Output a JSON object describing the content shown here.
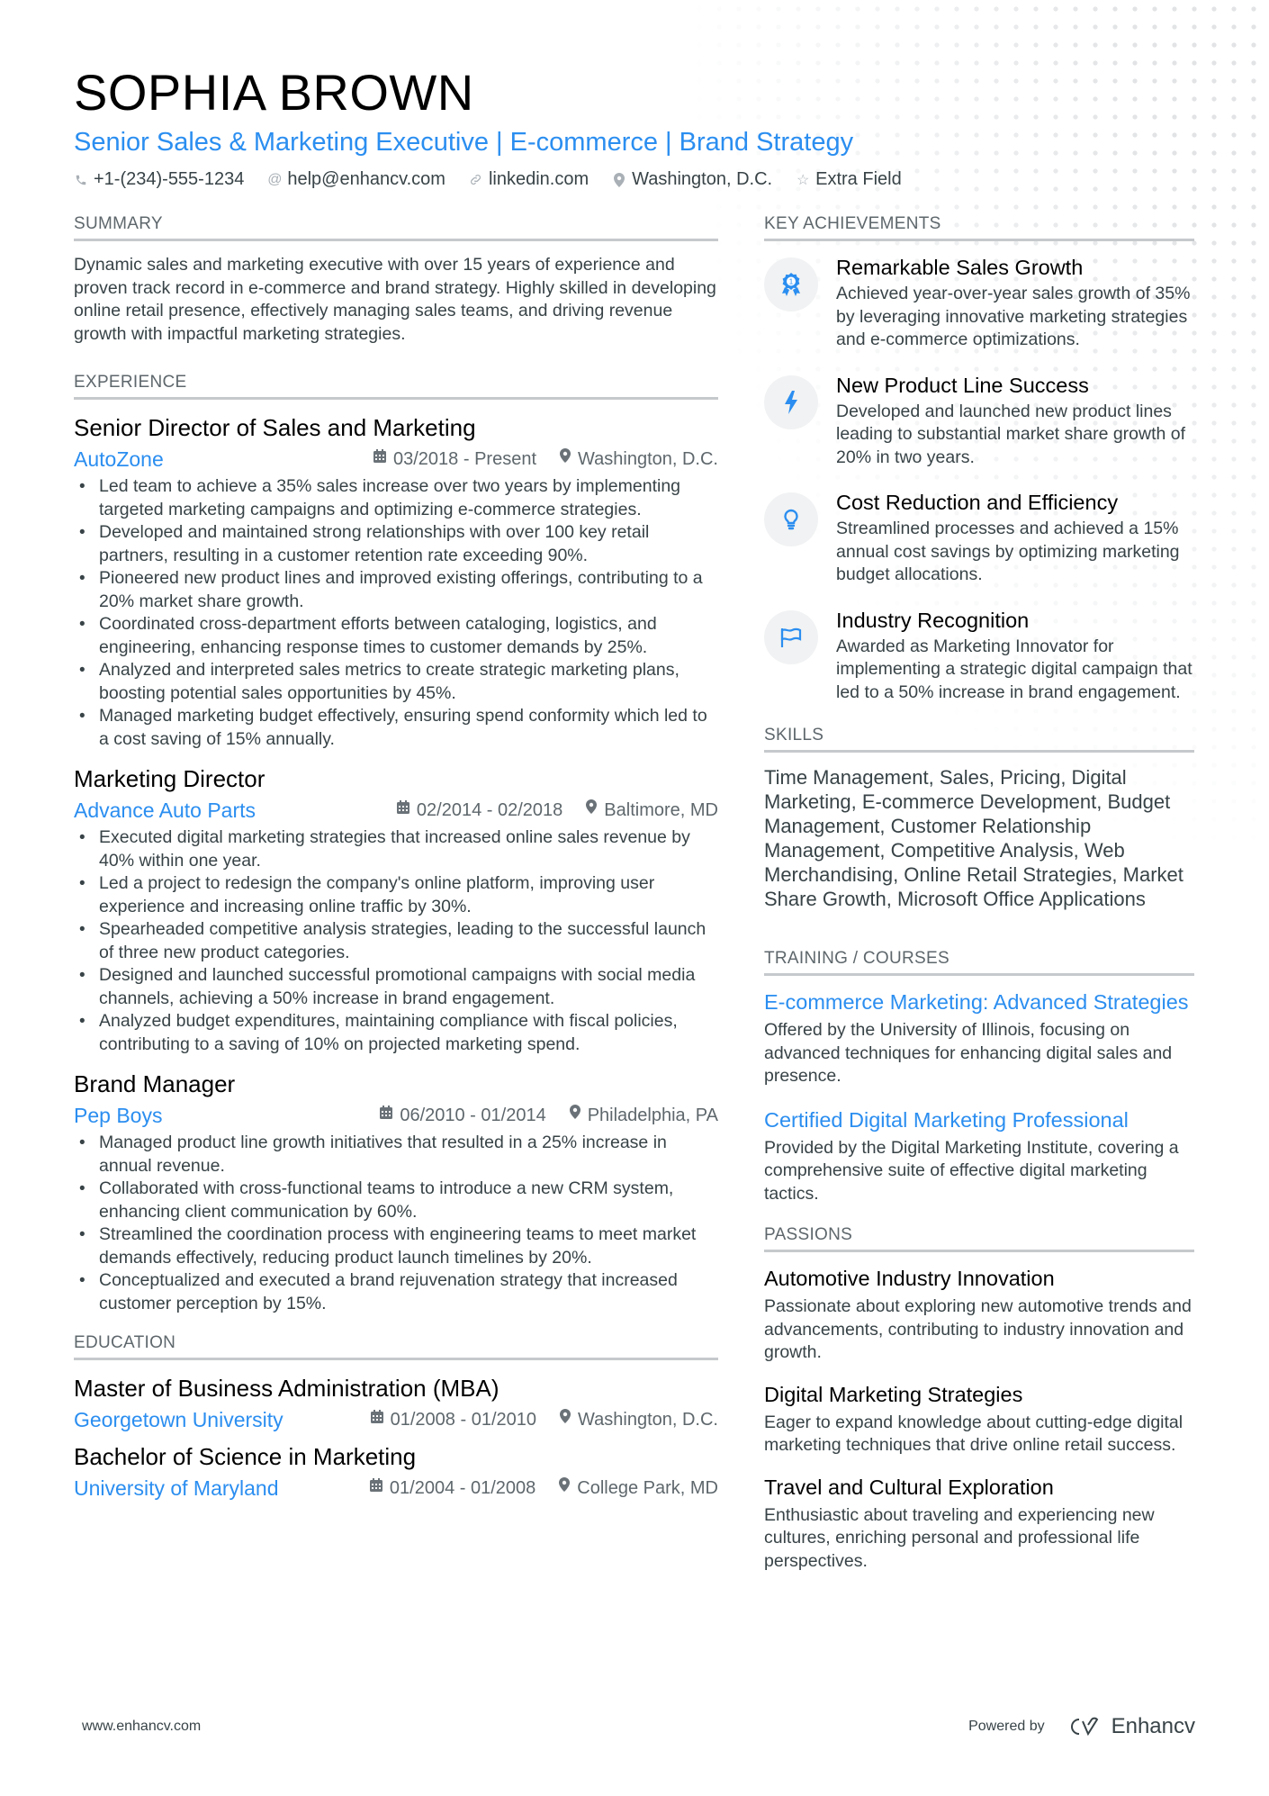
{
  "header": {
    "name": "SOPHIA BROWN",
    "headline": "Senior Sales & Marketing Executive | E-commerce | Brand Strategy",
    "contacts": [
      {
        "icon": "phone-icon",
        "glyph": "✆",
        "text": "+1-(234)-555-1234"
      },
      {
        "icon": "at-icon",
        "glyph": "@",
        "text": "help@enhancv.com"
      },
      {
        "icon": "link-icon",
        "glyph": "🔗",
        "text": "linkedin.com"
      },
      {
        "icon": "location-pin-icon",
        "glyph": "●",
        "text": "Washington, D.C."
      },
      {
        "icon": "star-icon",
        "glyph": "☆",
        "text": "Extra Field"
      }
    ]
  },
  "summary": {
    "title": "SUMMARY",
    "text": "Dynamic sales and marketing executive with over 15 years of experience and proven track record in e-commerce and brand strategy. Highly skilled in developing online retail presence, effectively managing sales teams, and driving revenue growth with impactful marketing strategies."
  },
  "experience": {
    "title": "EXPERIENCE",
    "jobs": [
      {
        "title": "Senior Director of Sales and Marketing",
        "company": "AutoZone",
        "dates": "03/2018 - Present",
        "location": "Washington, D.C.",
        "bullets": [
          "Led team to achieve a 35% sales increase over two years by implementing targeted marketing campaigns and optimizing e-commerce strategies.",
          "Developed and maintained strong relationships with over 100 key retail partners, resulting in a customer retention rate exceeding 90%.",
          "Pioneered new product lines and improved existing offerings, contributing to a 20% market share growth.",
          "Coordinated cross-department efforts between cataloging, logistics, and engineering, enhancing response times to customer demands by 25%.",
          "Analyzed and interpreted sales metrics to create strategic marketing plans, boosting potential sales opportunities by 45%.",
          "Managed marketing budget effectively, ensuring spend conformity which led to a cost saving of 15% annually."
        ]
      },
      {
        "title": "Marketing Director",
        "company": "Advance Auto Parts",
        "dates": "02/2014 - 02/2018",
        "location": "Baltimore, MD",
        "bullets": [
          "Executed digital marketing strategies that increased online sales revenue by 40% within one year.",
          "Led a project to redesign the company's online platform, improving user experience and increasing online traffic by 30%.",
          "Spearheaded competitive analysis strategies, leading to the successful launch of three new product categories.",
          "Designed and launched successful promotional campaigns with social media channels, achieving a 50% increase in brand engagement.",
          "Analyzed budget expenditures, maintaining compliance with fiscal policies, contributing to a saving of 10% on projected marketing spend."
        ]
      },
      {
        "title": "Brand Manager",
        "company": "Pep Boys",
        "dates": "06/2010 - 01/2014",
        "location": "Philadelphia, PA",
        "bullets": [
          "Managed product line growth initiatives that resulted in a 25% increase in annual revenue.",
          "Collaborated with cross-functional teams to introduce a new CRM system, enhancing client communication by 60%.",
          "Streamlined the coordination process with engineering teams to meet market demands effectively, reducing product launch timelines by 20%.",
          "Conceptualized and executed a brand rejuvenation strategy that increased customer perception by 15%."
        ]
      }
    ]
  },
  "education": {
    "title": "EDUCATION",
    "items": [
      {
        "degree": "Master of Business Administration (MBA)",
        "school": "Georgetown University",
        "dates": "01/2008 - 01/2010",
        "location": "Washington, D.C."
      },
      {
        "degree": "Bachelor of Science in Marketing",
        "school": "University of Maryland",
        "dates": "01/2004 - 01/2008",
        "location": "College Park, MD"
      }
    ]
  },
  "achievements": {
    "title": "KEY ACHIEVEMENTS",
    "items": [
      {
        "icon": "award-ribbon-icon",
        "title": "Remarkable Sales Growth",
        "desc": "Achieved year-over-year sales growth of 35% by leveraging innovative marketing strategies and e-commerce optimizations."
      },
      {
        "icon": "lightning-bolt-icon",
        "title": "New Product Line Success",
        "desc": "Developed and launched new product lines leading to substantial market share growth of 20% in two years."
      },
      {
        "icon": "lightbulb-icon",
        "title": "Cost Reduction and Efficiency",
        "desc": "Streamlined processes and achieved a 15% annual cost savings by optimizing marketing budget allocations."
      },
      {
        "icon": "flag-icon",
        "title": "Industry Recognition",
        "desc": "Awarded as Marketing Innovator for implementing a strategic digital campaign that led to a 50% increase in brand engagement."
      }
    ]
  },
  "skills": {
    "title": "SKILLS",
    "text": "Time Management, Sales, Pricing, Digital Marketing, E-commerce Development, Budget Management, Customer Relationship Management, Competitive Analysis, Web Merchandising, Online Retail Strategies, Market Share Growth, Microsoft Office Applications"
  },
  "training": {
    "title": "TRAINING / COURSES",
    "items": [
      {
        "title": "E-commerce Marketing: Advanced Strategies",
        "desc": "Offered by the University of Illinois, focusing on advanced techniques for enhancing digital sales and presence."
      },
      {
        "title": "Certified Digital Marketing Professional",
        "desc": "Provided by the Digital Marketing Institute, covering a comprehensive suite of effective digital marketing tactics."
      }
    ]
  },
  "passions": {
    "title": "PASSIONS",
    "items": [
      {
        "title": "Automotive Industry Innovation",
        "desc": "Passionate about exploring new automotive trends and advancements, contributing to industry innovation and growth."
      },
      {
        "title": "Digital Marketing Strategies",
        "desc": "Eager to expand knowledge about cutting-edge digital marketing techniques that drive online retail success."
      },
      {
        "title": "Travel and Cultural Exploration",
        "desc": "Enthusiastic about traveling and experiencing new cultures, enriching personal and professional life perspectives."
      }
    ]
  },
  "footer": {
    "website": "www.enhancv.com",
    "powered_by": "Powered by",
    "brand": "Enhancv"
  },
  "colors": {
    "accent": "#2b8ef0",
    "text": "#384347",
    "heading": "#000000",
    "section_title": "#5e676c",
    "divider": "#c6c9cc",
    "icon_bg": "#f1f2f3"
  }
}
